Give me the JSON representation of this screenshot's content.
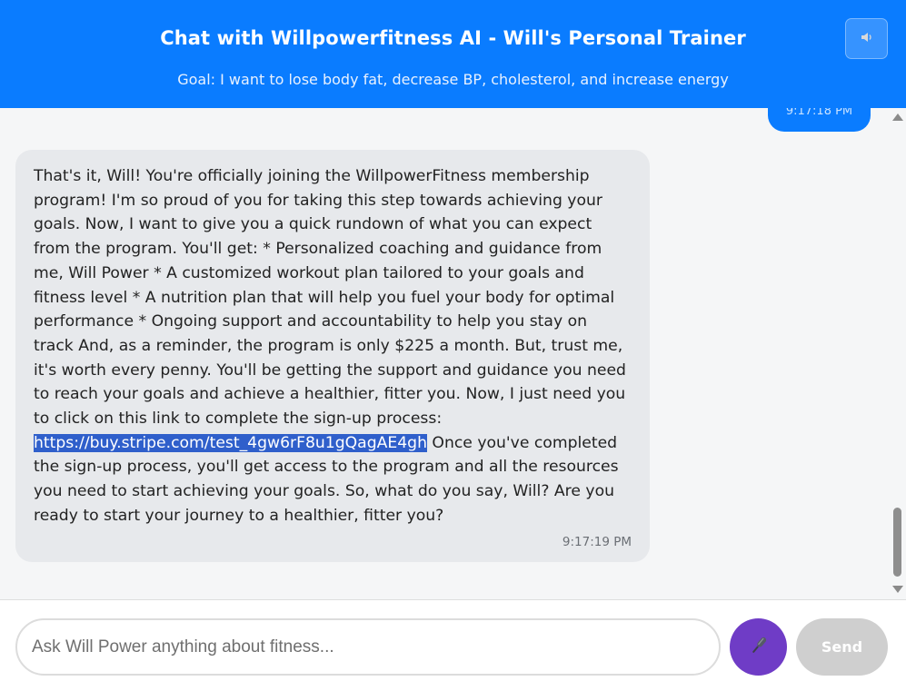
{
  "header": {
    "title": "Chat with Willpowerfitness AI - Will's Personal Trainer",
    "goal": "Goal: I want to lose body fat, decrease BP, cholesterol, and increase energy",
    "sound_icon": "speaker-icon"
  },
  "messages": [
    {
      "role": "user",
      "timestamp": "9:17:18 PM"
    },
    {
      "role": "assistant",
      "text_before_link": "That's it, Will! You're officially joining the WillpowerFitness membership program! I'm so proud of you for taking this step towards achieving your goals. Now, I want to give you a quick rundown of what you can expect from the program. You'll get: * Personalized coaching and guidance from me, Will Power * A customized workout plan tailored to your goals and fitness level * A nutrition plan that will help you fuel your body for optimal performance * Ongoing support and accountability to help you stay on track And, as a reminder, the program is only $225 a month. But, trust me, it's worth every penny. You'll be getting the support and guidance you need to reach your goals and achieve a healthier, fitter you. Now, I just need you to click on this link to complete the sign-up process:",
      "link": "https://buy.stripe.com/test_4gw6rF8u1gQagAE4gh",
      "text_after_link": " Once you've completed the sign-up process, you'll get access to the program and all the resources you need to start achieving your goals. So, what do you say, Will? Are you ready to start your journey to a healthier, fitter you?",
      "timestamp": "9:17:19 PM"
    }
  ],
  "input": {
    "placeholder": "Ask Will Power anything about fitness...",
    "value": ""
  },
  "mic_icon": "microphone-icon",
  "send_label": "Send",
  "colors": {
    "header_bg": "#0a7cff",
    "user_bubble": "#0a7cff",
    "assistant_bubble": "#e7e9ec",
    "mic_button": "#6f3cc6",
    "send_button_disabled": "#cfcfcf",
    "link_highlight": "#2f5fcb"
  }
}
